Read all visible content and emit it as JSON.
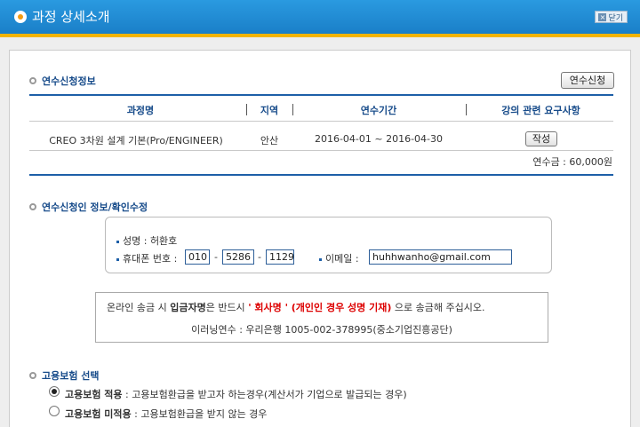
{
  "window": {
    "title": "과정 상세소개",
    "close_label": "닫기"
  },
  "enroll_info": {
    "section_title": "연수신청정보",
    "apply_button": "연수신청",
    "columns": [
      "과정명",
      "지역",
      "연수기간",
      "강의 관련 요구사항"
    ],
    "row": {
      "course": "CREO 3차원 설계 기본(Pro/ENGINEER)",
      "region": "안산",
      "period": "2016-04-01 ~ 2016-04-30",
      "write_button": "작성"
    },
    "fee": "연수금 : 60,000원"
  },
  "applicant": {
    "section_title": "연수신청인 정보/확인수정",
    "name_label": "성명 : 허환호",
    "phone_label": "휴대폰 번호 :",
    "phone": [
      "010",
      "5286",
      "1129"
    ],
    "phone_sep": "-",
    "email_label": "이메일 :",
    "email": "huhhwanho@gmail.com"
  },
  "notice": {
    "line1_a": "온라인 송금 시 ",
    "line1_b": "입금자명",
    "line1_c": "은 반드시 ",
    "line1_d": "' 회사명 ' (개인인 경우 성명 기재)",
    "line1_e": " 으로 송금해 주십시오.",
    "line2": "이러닝연수 : 우리은행 1005-002-378995(중소기업진흥공단)"
  },
  "insurance": {
    "section_title": "고용보험 선택",
    "options": [
      {
        "bold": "고용보험 적용",
        "text": " : 고용보험환급을 받고자 하는경우(계산서가 기업으로 발급되는 경우)",
        "selected": true
      },
      {
        "bold": "고용보험 미적용",
        "text": " : 고용보험환급을 받지 않는 경우",
        "selected": false
      }
    ]
  },
  "colors": {
    "header_blue": "#1a7fc8",
    "accent_yellow": "#f4b400",
    "section_blue": "#174b8a"
  }
}
